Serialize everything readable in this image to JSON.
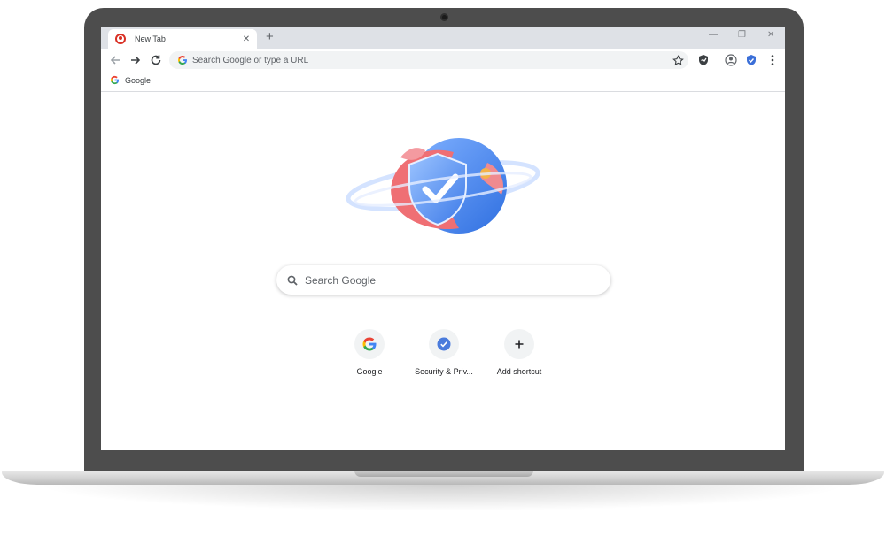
{
  "tab": {
    "title": "New Tab"
  },
  "omnibox": {
    "placeholder": "Search Google or type a URL"
  },
  "bookmarks": [
    {
      "label": "Google"
    }
  ],
  "ntp": {
    "search_placeholder": "Search Google",
    "shortcuts": [
      {
        "label": "Google",
        "icon": "google-g-icon"
      },
      {
        "label": "Security & Priv...",
        "icon": "shield-check-icon"
      },
      {
        "label": "Add shortcut",
        "icon": "plus-icon"
      }
    ]
  },
  "colors": {
    "bezel": "#4d4d4d",
    "tabstrip": "#dee1e6",
    "omnibox_bg": "#f1f3f4",
    "accent_blue": "#4a7bdc",
    "shield_blue": "#3b82f6",
    "illustration_red": "#e8606a"
  }
}
